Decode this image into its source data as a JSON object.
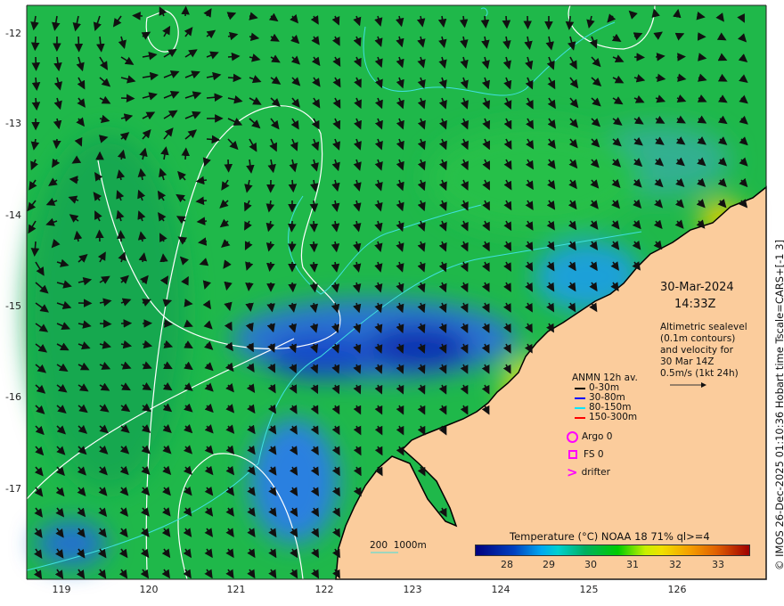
{
  "map": {
    "date": "30-Mar-2024",
    "time": "14:33Z",
    "description_lines": [
      "Altimetric sealevel",
      "(0.1m contours)",
      "and velocity for",
      "30 Mar 14Z",
      "0.5m/s (1kt 24h)"
    ],
    "legend": {
      "title": "ANMN 12h av.",
      "items": [
        {
          "label": "0-30m",
          "color": "#000000"
        },
        {
          "label": "30-80m",
          "color": "#0000ff"
        },
        {
          "label": "80-150m",
          "color": "#00e5ff"
        },
        {
          "label": "150-300m",
          "color": "#ff0000"
        }
      ]
    },
    "observations": [
      {
        "label": "Argo 0",
        "icon": "circle-icon",
        "color": "#ff00ff"
      },
      {
        "label": "FS 0",
        "icon": "square-icon",
        "color": "#ff00ff"
      },
      {
        "label": "drifter",
        "icon": "chevron-icon",
        "color": "#ff00ff"
      }
    ],
    "bathymetry_scale": "200  1000m",
    "colorbar": {
      "title": "Temperature (°C) NOAA 18 71% ql>=4",
      "ticks": [
        "28",
        "29",
        "30",
        "31",
        "32",
        "33"
      ],
      "range": [
        27.25,
        33.65
      ]
    },
    "lat_ticks": [
      "-12",
      "-13",
      "-14",
      "-15",
      "-16",
      "-17"
    ],
    "lon_ticks": [
      "119",
      "120",
      "121",
      "122",
      "123",
      "124",
      "125",
      "126"
    ],
    "credit": "© IMOS 26-Dec-2025 01:10:36 Hobart time Tscale=CARS+[-1 3]",
    "colors": {
      "land": "#fbcc9c",
      "sea_mid": "#00b84a",
      "contour": "#ffffff",
      "isobath": "#40e0e0"
    }
  }
}
